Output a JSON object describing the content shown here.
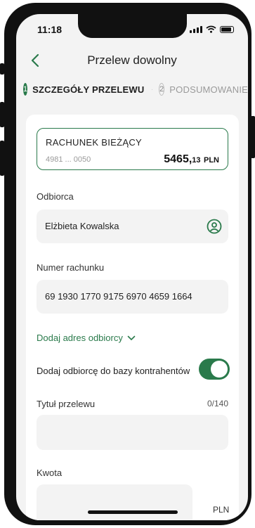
{
  "status_bar": {
    "time": "11:18"
  },
  "header": {
    "title": "Przelew dowolny"
  },
  "steps": [
    {
      "number": "1",
      "label": "SZCZEGÓŁY PRZELEWU"
    },
    {
      "number": "2",
      "label": "PODSUMOWANIE"
    }
  ],
  "account": {
    "name": "RACHUNEK BIEŻĄCY",
    "number": "4981 ... 0050",
    "balance_main": "5465,",
    "balance_decimal": "13",
    "currency": "PLN"
  },
  "recipient": {
    "label": "Odbiorca",
    "value": "Elżbieta Kowalska"
  },
  "account_number": {
    "label": "Numer rachunku",
    "value": "69 1930 1770 9175 6970 4659 1664"
  },
  "add_address": {
    "label": "Dodaj adres odbiorcy"
  },
  "add_to_contacts": {
    "label": "Dodaj odbiorcę do bazy kontrahentów",
    "enabled": true
  },
  "transfer_title": {
    "label": "Tytuł przelewu",
    "counter": "0/140",
    "value": ""
  },
  "amount": {
    "label": "Kwota",
    "currency": "PLN",
    "value": ""
  },
  "colors": {
    "accent": "#2a7a4b",
    "background": "#f3f3f3",
    "card": "#ffffff"
  },
  "icons": {
    "back": "chevron-left-icon",
    "recipient": "person-circle-icon",
    "expand": "chevron-down-icon"
  }
}
